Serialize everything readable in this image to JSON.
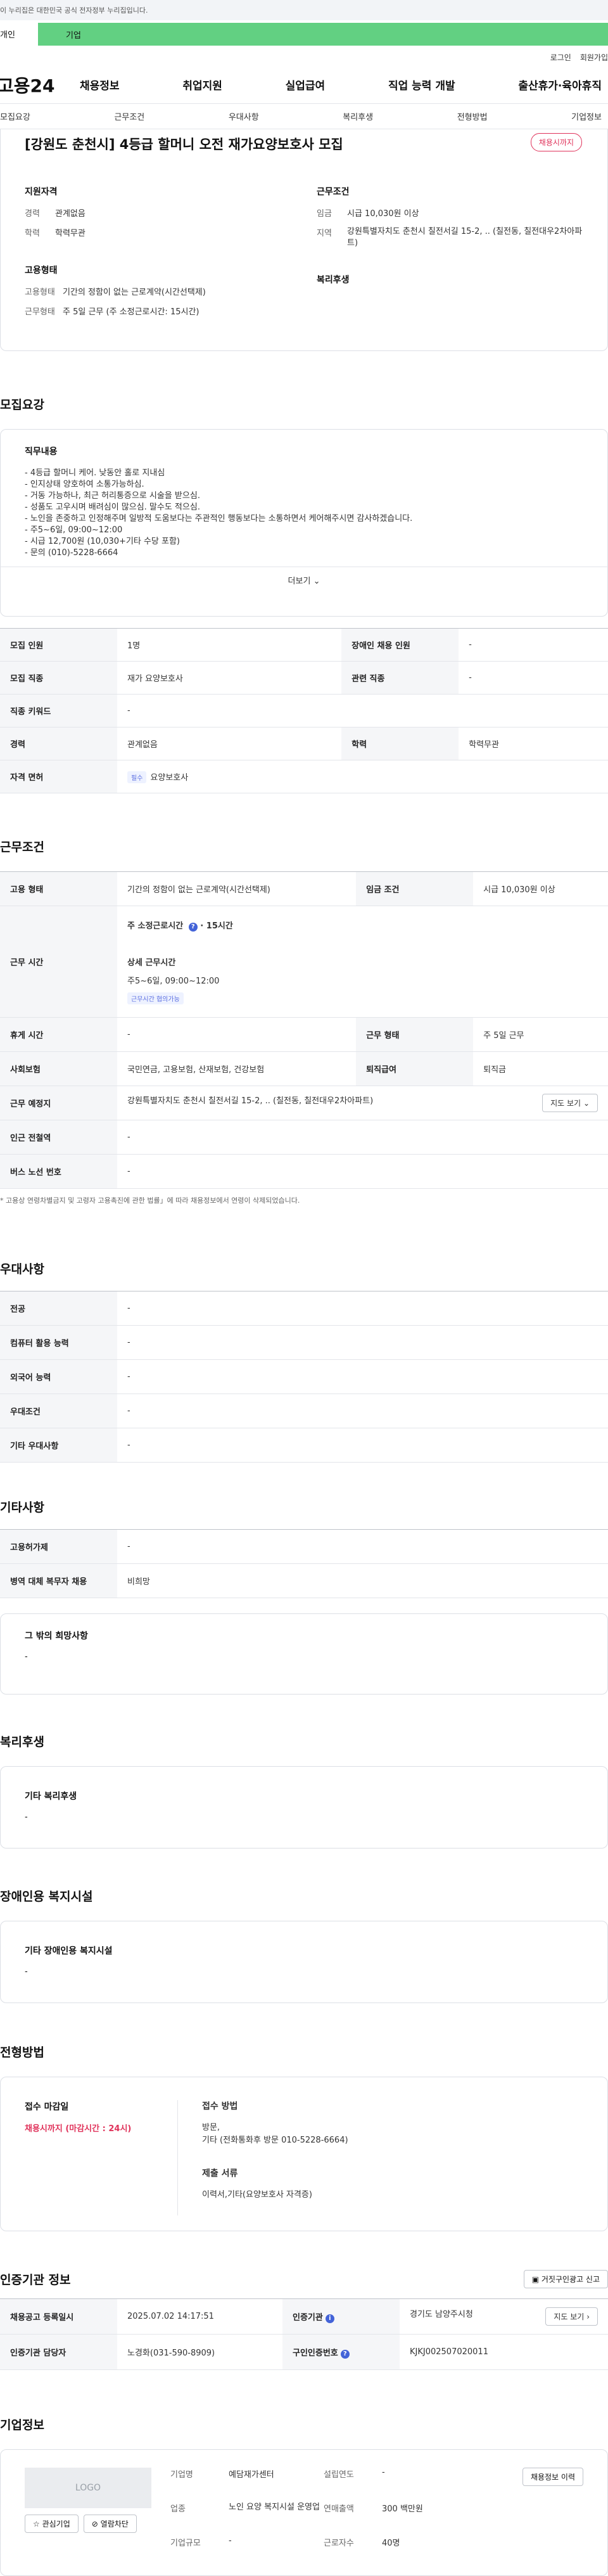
{
  "gov_banner": "이 누리집은 대한민국 공식 전자정부 누리집입니다.",
  "top_toggle": {
    "left": "개인",
    "right": "기업"
  },
  "util": {
    "login": "로그인",
    "join": "회원가입"
  },
  "logo": "고용24",
  "gnb": [
    "채용정보",
    "취업지원",
    "실업급여",
    "직업 능력 개발",
    "출산휴가·육아휴직"
  ],
  "subnav": [
    "모집요강",
    "근무조건",
    "우대사항",
    "복리후생",
    "전형방법",
    "기업정보"
  ],
  "summary": {
    "title": "[강원도 춘천시] 4등급 할머니 오전 재가요양보호사 모집",
    "badge": "채용시까지",
    "qual_head": "지원자격",
    "career_k": "경력",
    "career_v": "관계없음",
    "edu_k": "학력",
    "edu_v": "학력무관",
    "emp_head": "고용형태",
    "emp_k": "고용형태",
    "emp_v": "기간의 정함이 없는 근로계약(시간선택제)",
    "work_k": "근무형태",
    "work_v": "주 5일 근무 (주 소정근로시간: 15시간)",
    "cond_head": "근무조건",
    "wage_k": "임금",
    "wage_v": "시급 10,030원 이상",
    "region_k": "지역",
    "region_v": "강원특별자치도 춘천시 칠전서길 15-2, .. (칠전동, 칠전대우2차아파트)",
    "welfare_head": "복리후생"
  },
  "recruit": {
    "title": "모집요강",
    "desc_head": "직무내용",
    "desc": "- 4등급 할머니 케어. 낮동안 홀로 지내심\n- 인지상태 양호하여 소통가능하심.\n- 거동 가능하나, 최근 허리통증으로 시술을 받으심.\n- 성품도 고우시며 배려심이 많으심. 말수도 적으심.\n- 노인을 존중하고 인정해주며 일방적 도움보다는 주관적인 행동보다는 소통하면서 케어해주시면 감사하겠습니다.\n- 주5~6일, 09:00~12:00\n- 시급 12,700원 (10,030+기타 수당 포함)\n- 문의 (010)-5228-6664",
    "more": "더보기",
    "rows": [
      [
        "모집 인원",
        "1명",
        "장애인 채용 인원",
        "-"
      ],
      [
        "모집 직종",
        "재가 요양보호사",
        "관련 직종",
        "-"
      ],
      [
        "직종 키워드",
        "-",
        "",
        ""
      ],
      [
        "경력",
        "관계없음",
        "학력",
        "학력무관"
      ]
    ],
    "license_k": "자격 면허",
    "license_chip": "필수",
    "license_v": "요양보호사"
  },
  "conditions": {
    "title": "근무조건",
    "emp_k": "고용 형태",
    "emp_v": "기간의 정함이 없는 근로계약(시간선택제)",
    "wage_k": "임금 조건",
    "wage_v": "시급 10,030원 이상",
    "time_k": "근무 시간",
    "time_main": "주 소정근로시간",
    "time_hours": "15시간",
    "time_detail_head": "상세 근무시간",
    "time_detail": "주5~6일, 09:00~12:00",
    "time_chip": "근무시간 협의가능",
    "break_k": "휴게 시간",
    "break_v": "-",
    "shift_k": "근무 형태",
    "shift_v": "주 5일 근무",
    "ins_k": "사회보험",
    "ins_v": "국민연금, 고용보험, 산재보험, 건강보험",
    "retire_k": "퇴직급여",
    "retire_v": "퇴직금",
    "place_k": "근무 예정지",
    "place_v": "강원특별자치도 춘천시 칠전서길 15-2, .. (칠전동, 칠전대우2차아파트)",
    "map_btn": "지도 보기",
    "subway_k": "인근 전철역",
    "subway_v": "-",
    "bus_k": "버스 노선 번호",
    "bus_v": "-",
    "note": "* 고용상 연령차별금지 및 고령자 고용촉진에 관한 법률」에 따라 채용정보에서 연령이 삭제되었습니다."
  },
  "preference": {
    "title": "우대사항",
    "rows": [
      [
        "전공",
        "-"
      ],
      [
        "컴퓨터 활용 능력",
        "-"
      ],
      [
        "외국어 능력",
        "-"
      ],
      [
        "우대조건",
        "-"
      ],
      [
        "기타 우대사항",
        "-"
      ]
    ]
  },
  "etc": {
    "title": "기타사항",
    "rows": [
      [
        "고용허가제",
        "-"
      ],
      [
        "병역 대체 복무자 채용",
        "비희망"
      ]
    ],
    "other_head": "그 밖의 희망사항",
    "other_v": "-"
  },
  "welfare": {
    "title": "복리후생",
    "head": "기타 복리후생",
    "v": "-"
  },
  "disability": {
    "title": "장애인용 복지시설",
    "head": "기타 장애인용 복지시설",
    "v": "-"
  },
  "selection": {
    "title": "전형방법",
    "deadline_head": "접수 마감일",
    "deadline_v": "채용시까지 (마감시간 : 24시)",
    "method_head": "접수 방법",
    "method_v1": "방문,",
    "method_v2": "기타 (전화통화후 방문 010-5228-6664)",
    "docs_head": "제출 서류",
    "docs_v": "이력서,기타(요양보호사 자격증)"
  },
  "agency": {
    "title": "인증기관 정보",
    "report_btn": "거짓구인광고 신고",
    "reg_k": "채용공고 등록일시",
    "reg_v": "2025.07.02 14:17:51",
    "agency_k": "인증기관",
    "agency_v": "경기도 남양주시청",
    "map_btn": "지도 보기",
    "manager_k": "인증기관 담당자",
    "manager_v": "노경화(031-590-8909)",
    "id_k": "구인인증번호",
    "id_v": "KJKJ002507020011"
  },
  "company": {
    "title": "기업정보",
    "logo": "LOGO",
    "fav_btn": "관심기업",
    "block_btn": "열람차단",
    "name_k": "기업명",
    "name_v": "예담재가센터",
    "found_k": "설립연도",
    "found_v": "-",
    "jobs_btn": "채용정보 이력",
    "biz_k": "업종",
    "biz_v": "노인 요양 복지시설 운영업",
    "sales_k": "연매출액",
    "sales_v": "300 백만원",
    "emp_k": "근로자수",
    "emp_v": "40명",
    "size_k": "기업규모",
    "size_v": "-"
  }
}
